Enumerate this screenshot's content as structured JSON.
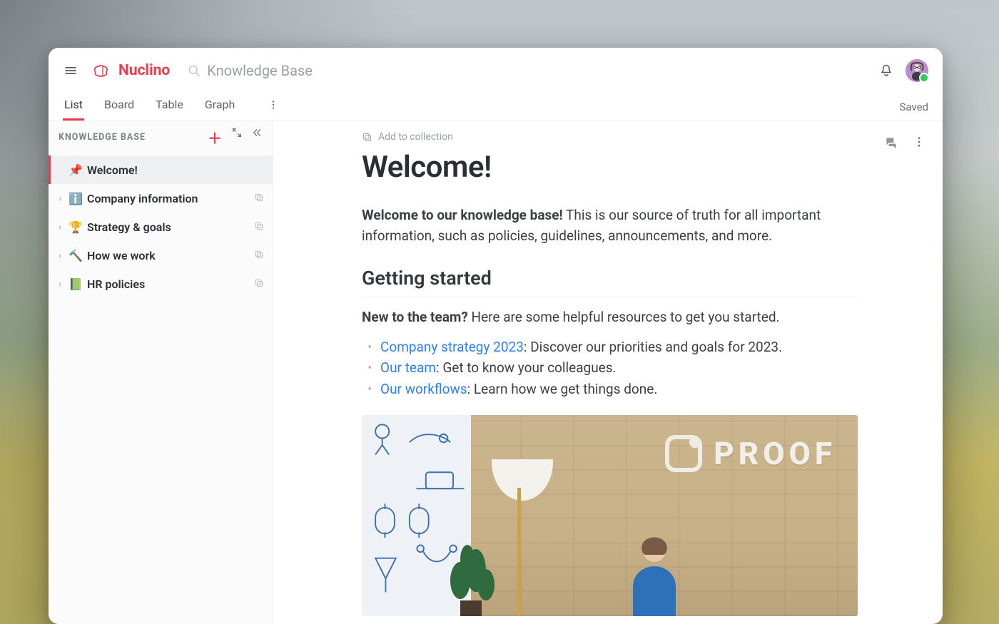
{
  "brand": {
    "name": "Nuclino"
  },
  "search": {
    "placeholder": "Knowledge Base"
  },
  "viewTabs": {
    "items": [
      {
        "label": "List",
        "active": true
      },
      {
        "label": "Board",
        "active": false
      },
      {
        "label": "Table",
        "active": false
      },
      {
        "label": "Graph",
        "active": false
      }
    ],
    "status": "Saved"
  },
  "sidebar": {
    "heading": "KNOWLEDGE BASE",
    "nodes": [
      {
        "icon": "📌",
        "label": "Welcome!",
        "selected": true,
        "expandable": false
      },
      {
        "icon": "ℹ️",
        "label": "Company information",
        "selected": false,
        "expandable": true
      },
      {
        "icon": "🏆",
        "label": "Strategy & goals",
        "selected": false,
        "expandable": true
      },
      {
        "icon": "🔨",
        "label": "How we work",
        "selected": false,
        "expandable": true
      },
      {
        "icon": "📗",
        "label": "HR policies",
        "selected": false,
        "expandable": true
      }
    ]
  },
  "doc": {
    "addToCollection": "Add to collection",
    "title": "Welcome!",
    "lead_bold": "Welcome to our knowledge base!",
    "lead_rest": " This is our source of truth for all important information, such as policies, guidelines, announcements, and more.",
    "section1": "Getting started",
    "sub_bold": "New to the team?",
    "sub_rest": " Here are some helpful resources to get you started.",
    "resources": [
      {
        "link": "Company strategy 2023",
        "rest": ": Discover our priorities and goals for 2023."
      },
      {
        "link": "Our team",
        "rest": ": Get to know your colleagues."
      },
      {
        "link": "Our workflows",
        "rest": ": Learn how we get things done."
      }
    ],
    "heroSign": "PROOF"
  }
}
